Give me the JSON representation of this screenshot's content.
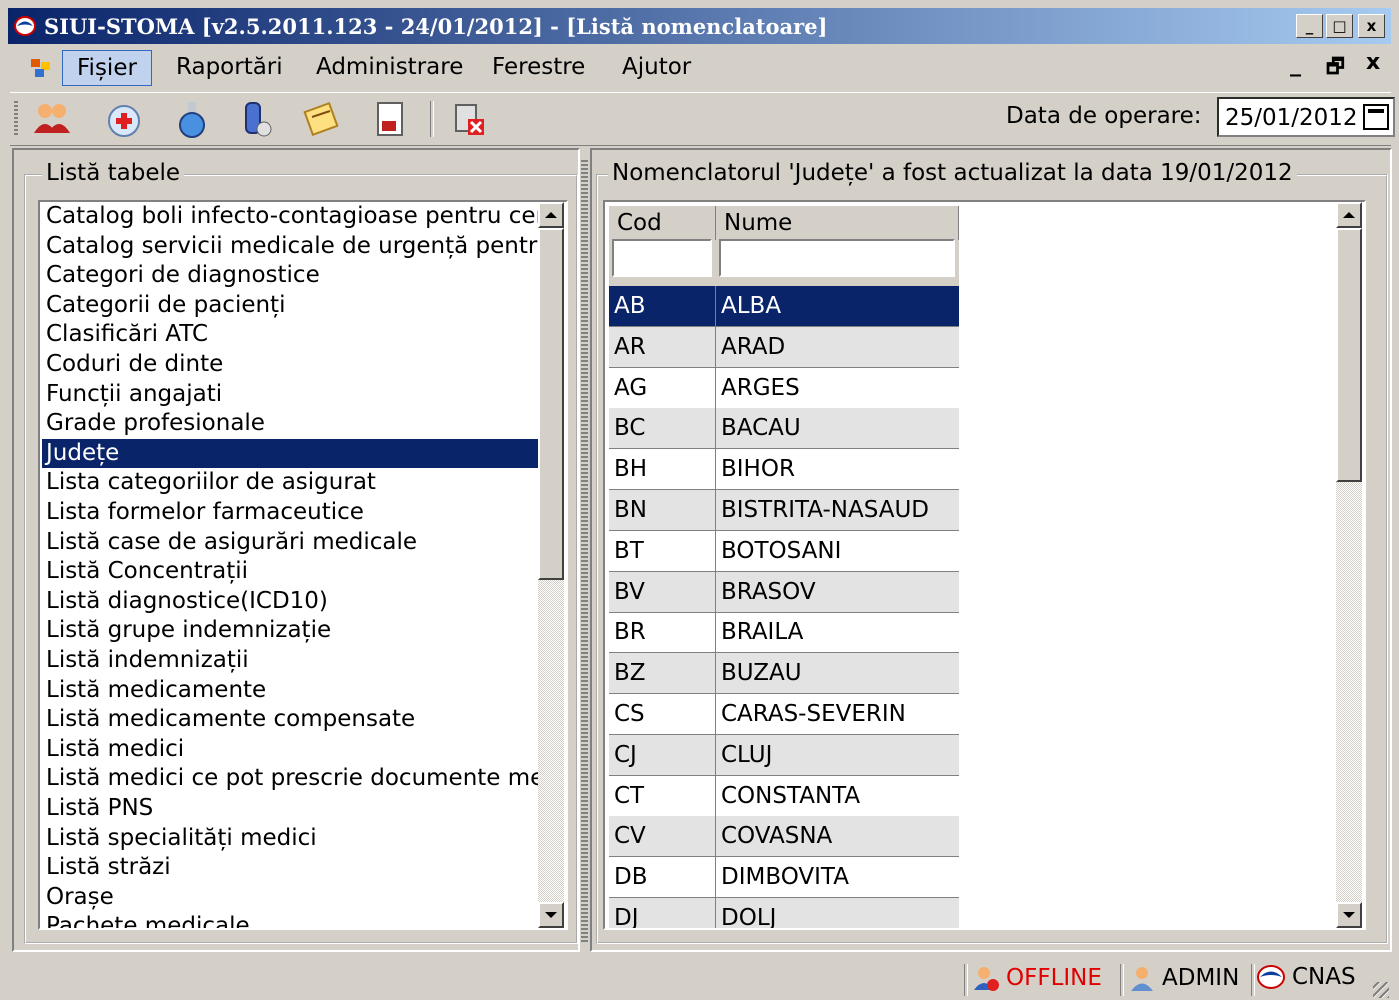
{
  "window": {
    "title": "SIUI-STOMA [v2.5.2011.123 - 24/01/2012] - [Listă nomenclatoare]",
    "minimize_label": "_",
    "restore_label": "□",
    "close_label": "x"
  },
  "menu": {
    "items": [
      "Fișier",
      "Raportări",
      "Administrare",
      "Ferestre",
      "Ajutor"
    ],
    "mdi_minimize": "_",
    "mdi_restore": "🗗",
    "mdi_close": "x"
  },
  "toolbar": {
    "icons": [
      "users-icon",
      "medical-kit-icon",
      "flask-icon",
      "lab-test-icon",
      "notes-icon",
      "report-icon",
      "delete-icon"
    ],
    "date_label": "Data de operare:",
    "date_value": "25/01/2012"
  },
  "left_panel": {
    "title": "Listă tabele",
    "selected_index": 8,
    "items": [
      "Catalog boli infecto-contagioase pentru certifi",
      "Catalog servicii medicale de urgență pentru c",
      "Categori de diagnostice",
      "Categorii de pacienți",
      "Clasificări ATC",
      "Coduri de dinte",
      "Funcții angajati",
      "Grade profesionale",
      "Județe",
      "Lista categoriilor de asigurat",
      "Lista formelor farmaceutice",
      "Listă case de asigurări medicale",
      "Listă Concentrații",
      "Listă diagnostice(ICD10)",
      "Listă grupe indemnizație",
      "Listă indemnizații",
      "Listă medicamente",
      "Listă medicamente compensate",
      "Listă medici",
      "Listă medici ce pot prescrie documente medi",
      "Listă PNS",
      "Listă specialități medici",
      "Listă străzi",
      "Orașe",
      "Pachete medicale"
    ]
  },
  "right_panel": {
    "title": "Nomenclatorul 'Județe' a fost actualizat la data 19/01/2012",
    "columns": [
      "Cod",
      "Nume"
    ],
    "filter_cod": "",
    "filter_nume": "",
    "selected_index": 0,
    "rows": [
      [
        "AB",
        "ALBA"
      ],
      [
        "AR",
        "ARAD"
      ],
      [
        "AG",
        "ARGES"
      ],
      [
        "BC",
        "BACAU"
      ],
      [
        "BH",
        "BIHOR"
      ],
      [
        "BN",
        "BISTRITA-NASAUD"
      ],
      [
        "BT",
        "BOTOSANI"
      ],
      [
        "BV",
        "BRASOV"
      ],
      [
        "BR",
        "BRAILA"
      ],
      [
        "BZ",
        "BUZAU"
      ],
      [
        "CS",
        "CARAS-SEVERIN"
      ],
      [
        "CJ",
        "CLUJ"
      ],
      [
        "CT",
        "CONSTANTA"
      ],
      [
        "CV",
        "COVASNA"
      ],
      [
        "DB",
        "DIMBOVITA"
      ],
      [
        "DJ",
        "DOLJ"
      ]
    ]
  },
  "status": {
    "connection": "OFFLINE",
    "connection_color": "#e00000",
    "user": "ADMIN",
    "org": "CNAS"
  },
  "colors": {
    "selection": "#0a246a",
    "title_gradient_start": "#0a246a",
    "title_gradient_end": "#a6caf0"
  }
}
